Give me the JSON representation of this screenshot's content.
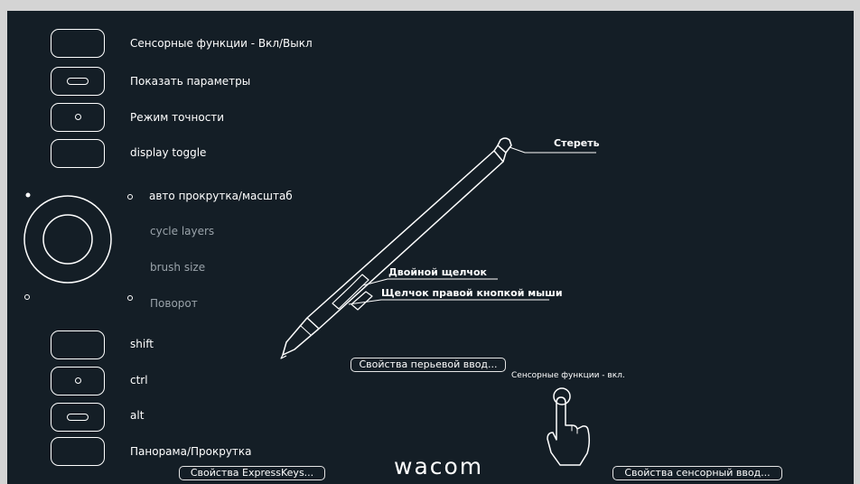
{
  "expresskeys_top": [
    {
      "label": "Сенсорные функции - Вкл/Выкл",
      "marker": "none"
    },
    {
      "label": "Показать параметры",
      "marker": "pill"
    },
    {
      "label": "Режим точности",
      "marker": "dot"
    },
    {
      "label": "display toggle",
      "marker": "none"
    }
  ],
  "touch_ring": {
    "items": [
      {
        "label": "авто прокрутка/масштаб"
      },
      {
        "label": "cycle layers"
      },
      {
        "label": "brush size"
      },
      {
        "label": "Поворот"
      }
    ]
  },
  "expresskeys_bottom": [
    {
      "label": "shift",
      "marker": "none"
    },
    {
      "label": "ctrl",
      "marker": "dot"
    },
    {
      "label": "alt",
      "marker": "pill"
    },
    {
      "label": "Панорама/Прокрутка",
      "marker": "none"
    }
  ],
  "pen": {
    "eraser_label": "Стереть",
    "upper_button_label": "Двойной щелчок",
    "lower_button_label": "Щелчок правой кнопкой мыши",
    "properties_button": "Свойства перьевой ввод..."
  },
  "touch": {
    "status_caption": "Сенсорные функции - вкл.",
    "properties_button": "Свойства сенсорный ввод..."
  },
  "expresskeys_properties_button": "Свойства ExpressKeys...",
  "brand": "wacom",
  "colors": {
    "background": "#141e26",
    "line": "#ffffff",
    "inactive_text": "#9aa3aa",
    "frame": "#d4d4d4"
  }
}
